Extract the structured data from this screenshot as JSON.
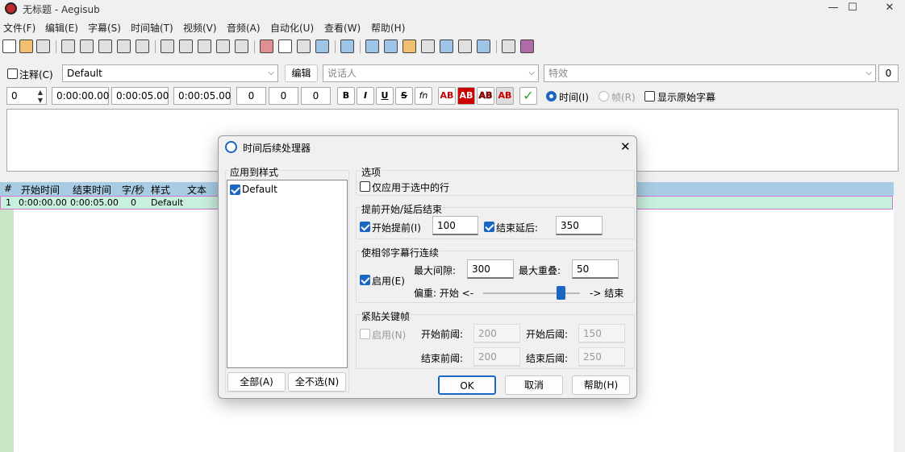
{
  "window": {
    "title": "无标题 - Aegisub",
    "minimize": "—",
    "maximize": "☐",
    "close": "✕"
  },
  "menu": [
    "文件(F)",
    "编辑(E)",
    "字幕(S)",
    "时间轴(T)",
    "视频(V)",
    "音频(A)",
    "自动化(U)",
    "查看(W)",
    "帮助(H)"
  ],
  "editor": {
    "comment_label": "注释(C)",
    "style_value": "Default",
    "edit_button": "编辑",
    "actor_placeholder": "说话人",
    "effect_placeholder": "特效",
    "effect_count": "0",
    "layer": "0",
    "start_time": "0:00:00.00",
    "end_time": "0:00:05.00",
    "duration": "0:00:05.00",
    "margin_l": "0",
    "margin_r": "0",
    "margin_v": "0",
    "bold": "B",
    "italic": "I",
    "underline": "U",
    "strike": "S",
    "fn": "fn",
    "color_buttons": [
      "AB",
      "AB",
      "AB",
      "AB"
    ],
    "commit": "✓",
    "time_radio": "时间(I)",
    "frame_radio": "帧(R)",
    "show_original": "显示原始字幕"
  },
  "grid": {
    "headers": [
      "#",
      "开始时间",
      "结束时间",
      "字/秒",
      "样式",
      "文本"
    ],
    "rows": [
      {
        "num": "1",
        "start": "0:00:00.00",
        "end": "0:00:05.00",
        "cps": "0",
        "style": "Default",
        "text": ""
      }
    ]
  },
  "dialog": {
    "title": "时间后续处理器",
    "styles_group": "应用到样式",
    "styles": [
      {
        "name": "Default",
        "checked": true
      }
    ],
    "select_all": "全部(A)",
    "select_none": "全不选(N)",
    "options_group": "选项",
    "only_selected": "仅应用于选中的行",
    "lead_group": "提前开始/延后结束",
    "lead_in_label": "开始提前(I)",
    "lead_in_value": "100",
    "lead_out_label": "结束延后:",
    "lead_out_value": "350",
    "adjacent_group": "使相邻字幕行连续",
    "adjacent_enable": "启用(E)",
    "max_gap_label": "最大间隙:",
    "max_gap_value": "300",
    "max_overlap_label": "最大重叠:",
    "max_overlap_value": "50",
    "bias_label": "偏重: 开始 <-",
    "bias_end_label": "-> 结束",
    "bias_value": 0.8,
    "keyframe_group": "紧贴关键帧",
    "keyframe_enable": "启用(N)",
    "before_start_label": "开始前阈:",
    "before_start_value": "200",
    "after_start_label": "开始后阈:",
    "after_start_value": "150",
    "before_end_label": "结束前阈:",
    "before_end_value": "200",
    "after_end_label": "结束后阈:",
    "after_end_value": "250",
    "ok": "OK",
    "cancel": "取消",
    "help": "帮助(H)",
    "close": "✕"
  },
  "colors": {
    "accent": "#1a66c4",
    "grid_header": "#a8cce4",
    "row_selected": "#c8f0de",
    "gutter": "#c6e6c6"
  }
}
